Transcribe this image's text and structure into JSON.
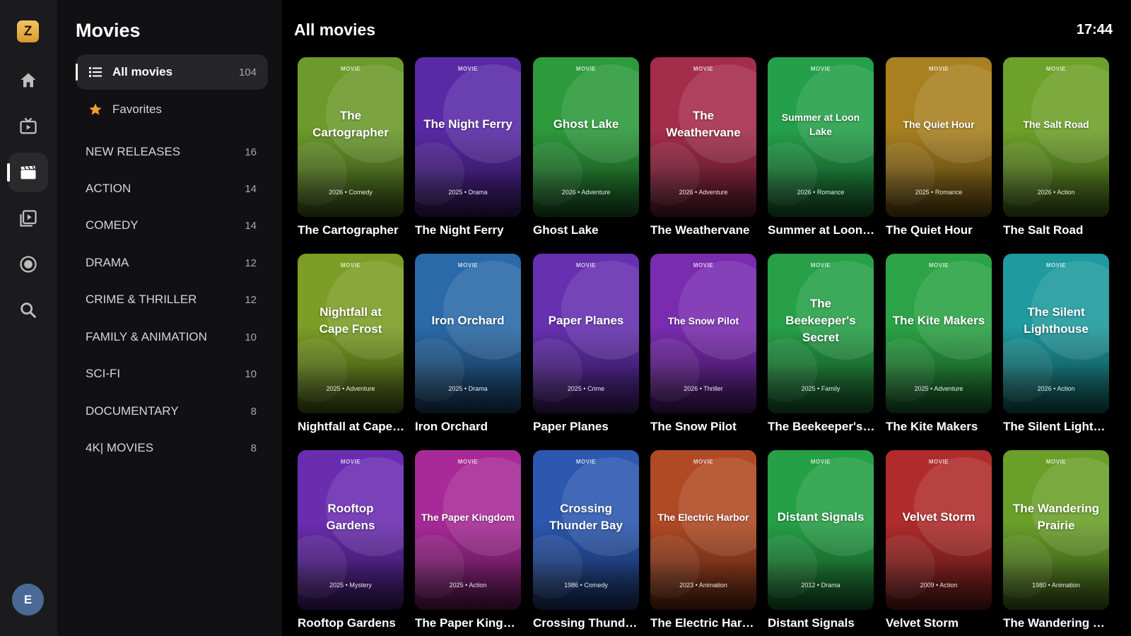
{
  "app": {
    "logo_letter": "Z",
    "user_initial": "E"
  },
  "rail": [
    {
      "icon": "home-icon",
      "active": false
    },
    {
      "icon": "live-tv-icon",
      "active": false
    },
    {
      "icon": "movies-icon",
      "active": true
    },
    {
      "icon": "series-icon",
      "active": false
    },
    {
      "icon": "record-icon",
      "active": false
    },
    {
      "icon": "search-icon",
      "active": false
    }
  ],
  "panel": {
    "title": "Movies",
    "all": {
      "label": "All movies",
      "count": "104"
    },
    "favorites": {
      "label": "Favorites"
    },
    "categories": [
      {
        "label": "NEW RELEASES",
        "count": "16"
      },
      {
        "label": "ACTION",
        "count": "14"
      },
      {
        "label": "COMEDY",
        "count": "14"
      },
      {
        "label": "DRAMA",
        "count": "12"
      },
      {
        "label": "CRIME & THRILLER",
        "count": "12"
      },
      {
        "label": "FAMILY & ANIMATION",
        "count": "10"
      },
      {
        "label": "SCI-FI",
        "count": "10"
      },
      {
        "label": "DOCUMENTARY",
        "count": "8"
      },
      {
        "label": "4K| MOVIES",
        "count": "8"
      }
    ]
  },
  "main": {
    "title": "All movies",
    "clock": "17:44",
    "poster_tag": "MOVIE"
  },
  "movies": [
    {
      "poster_title": "The Cartographer",
      "meta": "2026 • Comedy",
      "name": "The Cartographer",
      "color": "#6c9a2c"
    },
    {
      "poster_title": "The Night Ferry",
      "meta": "2025 • Drama",
      "name": "The Night Ferry",
      "color": "#5a2aa6"
    },
    {
      "poster_title": "Ghost Lake",
      "meta": "2026 • Adventure",
      "name": "Ghost Lake",
      "color": "#2d9a3c"
    },
    {
      "poster_title": "The Weathervane",
      "meta": "2026 • Adventure",
      "name": "The Weathervane",
      "color": "#a52d4c"
    },
    {
      "poster_title": "Summer at Loon Lake",
      "meta": "2026 • Romance",
      "name": "Summer at Loon ...",
      "color": "#25a04a"
    },
    {
      "poster_title": "The Quiet Hour",
      "meta": "2025 • Romance",
      "name": "The Quiet Hour",
      "color": "#a88020"
    },
    {
      "poster_title": "The Salt Road",
      "meta": "2026 • Action",
      "name": "The Salt Road",
      "color": "#6ea12a"
    },
    {
      "poster_title": "Nightfall at Cape Frost",
      "meta": "2025 • Adventure",
      "name": "Nightfall at Cape ...",
      "color": "#7c9e26"
    },
    {
      "poster_title": "Iron Orchard",
      "meta": "2025 • Drama",
      "name": "Iron Orchard",
      "color": "#2a6aa8"
    },
    {
      "poster_title": "Paper Planes",
      "meta": "2025 • Crime",
      "name": "Paper Planes",
      "color": "#6630b0"
    },
    {
      "poster_title": "The Snow Pilot",
      "meta": "2026 • Thriller",
      "name": "The Snow Pilot",
      "color": "#7a2cb0"
    },
    {
      "poster_title": "The Beekeeper's Secret",
      "meta": "2025 • Family",
      "name": "The Beekeeper's ...",
      "color": "#27a048"
    },
    {
      "poster_title": "The Kite Makers",
      "meta": "2025 • Adventure",
      "name": "The Kite Makers",
      "color": "#2ca346"
    },
    {
      "poster_title": "The Silent Lighthouse",
      "meta": "2026 • Action",
      "name": "The Silent Lighth...",
      "color": "#1f9a9e"
    },
    {
      "poster_title": "Rooftop Gardens",
      "meta": "2025 • Mystery",
      "name": "Rooftop Gardens",
      "color": "#6a2db0"
    },
    {
      "poster_title": "The Paper Kingdom",
      "meta": "2025 • Action",
      "name": "The Paper Kingdom",
      "color": "#a82a98"
    },
    {
      "poster_title": "Crossing Thunder Bay",
      "meta": "1986 • Comedy",
      "name": "Crossing Thunder...",
      "color": "#2c58b0"
    },
    {
      "poster_title": "The Electric Harbor",
      "meta": "2023 • Animation",
      "name": "The Electric Harbor",
      "color": "#b04a24"
    },
    {
      "poster_title": "Distant Signals",
      "meta": "2012 • Drama",
      "name": "Distant Signals",
      "color": "#26a046"
    },
    {
      "poster_title": "Velvet Storm",
      "meta": "2009 • Action",
      "name": "Velvet Storm",
      "color": "#b02c2c"
    },
    {
      "poster_title": "The Wandering Prairie",
      "meta": "1980 • Animation",
      "name": "The Wandering Pr...",
      "color": "#6aa02a"
    }
  ]
}
